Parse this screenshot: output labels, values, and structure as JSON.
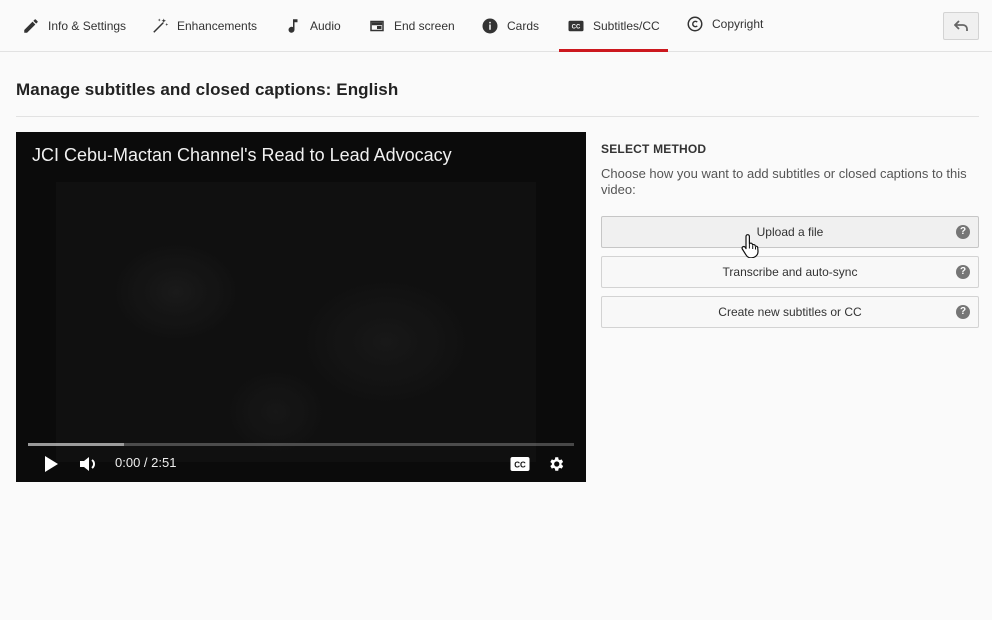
{
  "tabs": [
    {
      "label": "Info & Settings",
      "icon": "pencil-icon"
    },
    {
      "label": "Enhancements",
      "icon": "magic-wand-icon"
    },
    {
      "label": "Audio",
      "icon": "music-note-icon"
    },
    {
      "label": "End screen",
      "icon": "end-screen-icon"
    },
    {
      "label": "Cards",
      "icon": "info-icon"
    },
    {
      "label": "Subtitles/CC",
      "icon": "cc-icon",
      "active": true
    },
    {
      "label": "Copyright",
      "icon": "copyright-icon"
    }
  ],
  "back_button": {
    "icon": "back-arrow-icon"
  },
  "page_title": "Manage subtitles and closed captions: English",
  "player": {
    "video_title": "JCI Cebu-Mactan Channel's Read to Lead Advocacy",
    "time": "0:00 / 2:51",
    "progress_fraction": 0.0,
    "loaded_fraction": 0.175,
    "controls": [
      "play-icon",
      "volume-icon",
      "cc-icon",
      "settings-gear-icon"
    ]
  },
  "select_method": {
    "heading": "SELECT METHOD",
    "description": "Choose how you want to add subtitles or closed captions to this video:",
    "buttons": [
      {
        "label": "Upload a file",
        "help": "?"
      },
      {
        "label": "Transcribe and auto-sync",
        "help": "?"
      },
      {
        "label": "Create new subtitles or CC",
        "help": "?"
      }
    ]
  },
  "colors": {
    "accent": "#cc181e",
    "background": "#fafafa",
    "player_bg": "#0b0b0b"
  }
}
